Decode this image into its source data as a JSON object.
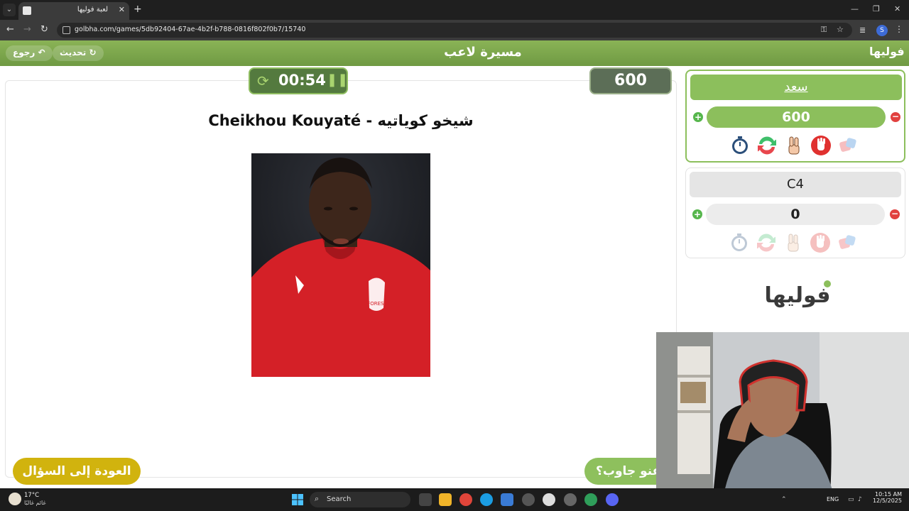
{
  "browser": {
    "tab_title": "لعبة فوليها",
    "url": "golbha.com/games/5db92404-67ae-4b2f-b788-0816f802f0b7/15740",
    "profile_initial": "S"
  },
  "header": {
    "back_label": "رجوع",
    "refresh_label": "تحديث",
    "title": "مسيرة لاعب",
    "logo_text": "فوليها"
  },
  "game": {
    "timer": "00:54",
    "points": "600 نقطة",
    "player_name": "Cheikhou Kouyaté - شيخو كوياتيه",
    "back_to_question_label": "العودة إلى السؤال",
    "who_answered_label": "عنو جاوب؟"
  },
  "teams": [
    {
      "name": "سعد",
      "score": "600",
      "active": true
    },
    {
      "name": "C4",
      "score": "0",
      "active": false
    }
  ],
  "powerup_icons": [
    "stopwatch-icon",
    "swap-icon",
    "two-fingers-icon",
    "stop-hand-icon",
    "dice-icon"
  ],
  "sidebar_logo_text": "فوليها",
  "taskbar": {
    "weather_temp": "17°C",
    "weather_desc": "غائم غالبًا",
    "search_label": "Search",
    "lang": "ENG",
    "time": "10:15 AM",
    "date": "12/5/2025"
  },
  "colors": {
    "brand_green": "#8cbf5c",
    "timer_bg": "#547a3f",
    "points_bg": "#5c6e57",
    "back_button": "#d1b30e",
    "minus_red": "#e1413f",
    "plus_green": "#56b64c"
  }
}
